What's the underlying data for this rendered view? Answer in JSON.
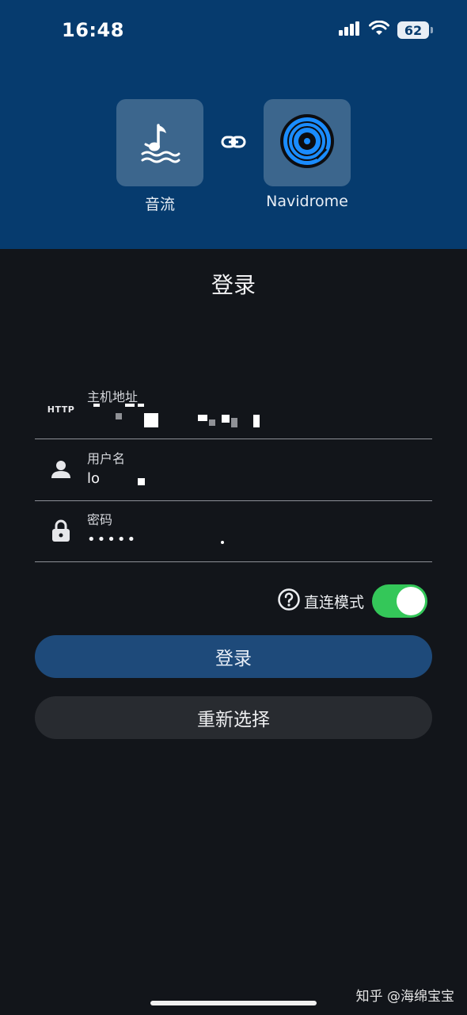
{
  "status_bar": {
    "time": "16:48",
    "battery": "62"
  },
  "header": {
    "source_app": {
      "name": "音流",
      "icon": "music-note-waves-icon"
    },
    "connector_icon": "link-icon",
    "target_app": {
      "name": "Navidrome",
      "icon": "vinyl-disc-icon"
    },
    "colors": {
      "background": "#063b6e",
      "disc_blue": "#1a8cff"
    }
  },
  "title": "登录",
  "form": {
    "host": {
      "label": "主机地址",
      "prefix": "HTTP"
    },
    "username": {
      "label": "用户名",
      "value": "lo",
      "icon": "person-icon"
    },
    "password": {
      "label": "密码",
      "value": "•••••",
      "icon": "lock-icon"
    }
  },
  "direct_mode": {
    "label": "直连模式",
    "enabled": true,
    "help_icon": "help-circle-icon",
    "toggle_color": "#34c759"
  },
  "buttons": {
    "login": "登录",
    "reselect": "重新选择"
  },
  "watermark": "知乎 @海绵宝宝"
}
